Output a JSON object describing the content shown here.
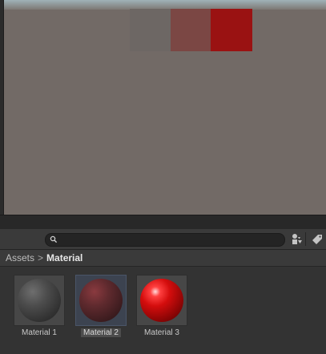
{
  "scene_view": {
    "cubes": [
      {
        "name": "grey",
        "color": "#6d6764"
      },
      {
        "name": "dark-red",
        "color": "#7b4744"
      },
      {
        "name": "red",
        "color": "#9a1212"
      }
    ]
  },
  "toolbar": {
    "search_value": "",
    "search_icon": "search-icon",
    "filter_icon": "filter-by-type-icon",
    "label_icon": "filter-by-label-icon"
  },
  "breadcrumb": {
    "items": [
      "Assets",
      "Material"
    ],
    "separator": ">"
  },
  "assets": [
    {
      "label": "Material 1",
      "color": "#4c4c4c",
      "selected": false
    },
    {
      "label": "Material 2",
      "color": "#5f2a2e",
      "selected": true
    },
    {
      "label": "Material 3",
      "color": "#d40d0d",
      "selected": false
    }
  ]
}
